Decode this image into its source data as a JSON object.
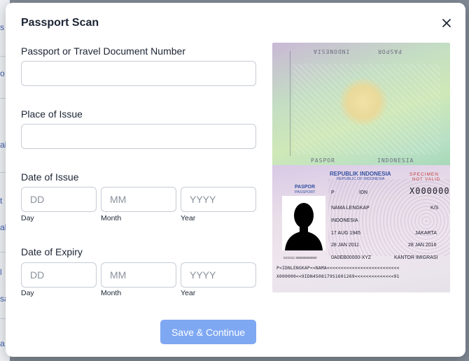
{
  "background": {
    "fragments": [
      "s",
      "o",
      "al",
      "t",
      "al",
      "l",
      "sa",
      "a"
    ]
  },
  "modal": {
    "title": "Passport Scan",
    "close_icon": "close-icon",
    "fields": {
      "document_number": {
        "label": "Passport or Travel Document Number",
        "value": "",
        "placeholder": ""
      },
      "place_of_issue": {
        "label": "Place of Issue",
        "value": "",
        "placeholder": ""
      },
      "date_of_issue": {
        "label": "Date of Issue",
        "day": {
          "placeholder": "DD",
          "sublabel": "Day"
        },
        "month": {
          "placeholder": "MM",
          "sublabel": "Month"
        },
        "year": {
          "placeholder": "YYYY",
          "sublabel": "Year"
        }
      },
      "date_of_expiry": {
        "label": "Date of Expiry",
        "day": {
          "placeholder": "DD",
          "sublabel": "Day"
        },
        "month": {
          "placeholder": "MM",
          "sublabel": "Month"
        },
        "year": {
          "placeholder": "YYYY",
          "sublabel": "Year"
        }
      }
    },
    "submit_label": "Save & Continue",
    "colors": {
      "primary_disabled": "#7fa8f3",
      "text": "#1b2433"
    }
  },
  "passport_image": {
    "country": "REPUBLIK INDONESIA",
    "country_en": "REPUBLIC OF INDONESIA",
    "doc_label": "PASPOR",
    "doc_label_en": "PASSPORT",
    "type": "P",
    "code": "IDN",
    "number": "X000000",
    "specimen": "SPECIMEN",
    "not_valid": "NOT VALID",
    "name": "NAMA LENGKAP",
    "sex": "K/S",
    "nationality": "INDONESIA",
    "birth_date": "17 AUG 1945",
    "birth_place": "JAKARTA",
    "issue_date": "28 JAN 2011",
    "expiry_date": "28 JAN 2016",
    "reg_no": "0A0EB00000-XYZ",
    "office": "KANTOR IMIGRASI",
    "photo_code": "CCCCC 000000000000",
    "top_text": "PASPOR",
    "top_text_2": "INDONESIA",
    "mrz_1": "P<IDNLENGKAP<<NAMA<<<<<<<<<<<<<<<<<<<<<<<<<<",
    "mrz_2": "X000000<<9IDN4508179S1601269<<<<<<<<<<<<<<91"
  }
}
